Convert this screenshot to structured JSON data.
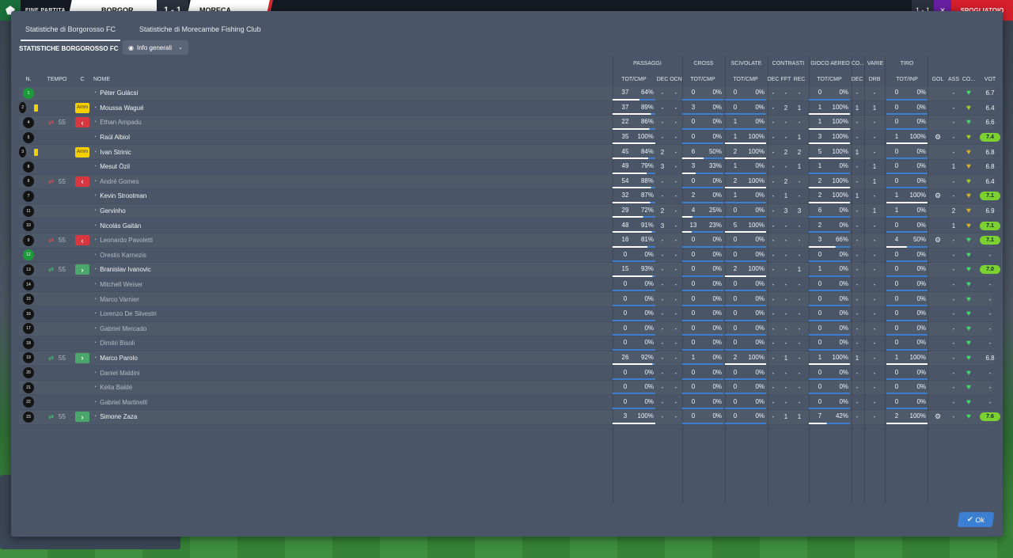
{
  "topbar": {
    "left_label": "FINE PARTITA",
    "home_team": "BORGOR",
    "away_team": "MORECA",
    "score": "1 - 1",
    "mini_score": "1 - 1",
    "right_label": "SPOGLIATOIO"
  },
  "dialog": {
    "tabs": [
      "Statistiche di Borgorosso FC",
      "Statistiche di Morecambe Fishing Club"
    ],
    "section_title": "STATISTICHE BORGOROSSO FC",
    "dropdown_label": "Info generali",
    "ok_label": "Ok"
  },
  "groups": [
    {
      "label": "PASSAGGI",
      "span": "pass"
    },
    {
      "label": "CROSS",
      "span": "cross"
    },
    {
      "label": "SCIVOLATE",
      "span": "tackle"
    },
    {
      "label": "CONTRASTI",
      "span": "contr"
    },
    {
      "label": "GIOCO AEREO",
      "span": "air"
    },
    {
      "label": "CO...",
      "span": "co"
    },
    {
      "label": "VARIE",
      "span": "varie"
    },
    {
      "label": "TIRO",
      "span": "tiro"
    }
  ],
  "columns": {
    "n": "N.",
    "tempo": "TEMPO",
    "c": "C",
    "nome": "NOME",
    "pass_tot": "TOT/CMP",
    "dec": "DEC",
    "ocn": "OCN",
    "cross_tot": "TOT/CMP",
    "tackle_tot": "TOT/CMP",
    "contr_dec": "DEC",
    "contr_fft": "FFT",
    "contr_rec": "REC",
    "air_tot": "TOT/CMP",
    "co_dec": "DEC",
    "drb": "DRB",
    "tiro_tot": "TOT/INP",
    "gol": "GOL",
    "ass": "ASS",
    "co": "CO...",
    "vot": "VOT"
  },
  "players": [
    {
      "n": "1",
      "gk": true,
      "card": "",
      "tempo": "",
      "badge": "",
      "name": "Péter Gulácsi",
      "dim": false,
      "pass": [
        "37",
        "64%"
      ],
      "dec": "-",
      "ocn": "-",
      "cross": [
        "0",
        "0%"
      ],
      "tackle": [
        "0",
        "0%"
      ],
      "cd": "-",
      "cf": "-",
      "cr": "-",
      "air": [
        "0",
        "0%"
      ],
      "codec": "-",
      "drb": "-",
      "tiro": [
        "0",
        "0%"
      ],
      "gol": "",
      "ass": "-",
      "cond": "good",
      "vot": "6.7",
      "vot_hl": false
    },
    {
      "n": "2",
      "gk": false,
      "card": "y",
      "tempo": "",
      "badge": "amm",
      "badge_text": "Amm",
      "name": "Moussa Wagué",
      "dim": false,
      "pass": [
        "37",
        "89%"
      ],
      "dec": "-",
      "ocn": "-",
      "cross": [
        "3",
        "0%"
      ],
      "tackle": [
        "0",
        "0%"
      ],
      "cd": "-",
      "cf": "2",
      "cr": "1",
      "air": [
        "1",
        "100%"
      ],
      "codec": "1",
      "drb": "1",
      "tiro": [
        "0",
        "0%"
      ],
      "gol": "",
      "ass": "-",
      "cond": "warn",
      "vot": "6.4",
      "vot_hl": false
    },
    {
      "n": "4",
      "gk": false,
      "card": "",
      "sub": "out",
      "tempo": "55",
      "badge": "out",
      "badge_text": "‹",
      "name": "Ethan Ampadu",
      "dim": true,
      "pass": [
        "22",
        "86%"
      ],
      "dec": "-",
      "ocn": "-",
      "cross": [
        "0",
        "0%"
      ],
      "tackle": [
        "1",
        "0%"
      ],
      "cd": "-",
      "cf": "-",
      "cr": "-",
      "air": [
        "1",
        "100%"
      ],
      "codec": "-",
      "drb": "-",
      "tiro": [
        "0",
        "0%"
      ],
      "gol": "",
      "ass": "-",
      "cond": "good",
      "vot": "6.6",
      "vot_hl": false
    },
    {
      "n": "5",
      "gk": false,
      "card": "",
      "tempo": "",
      "badge": "",
      "name": "Raúl Albiol",
      "dim": false,
      "pass": [
        "35",
        "100%"
      ],
      "dec": "-",
      "ocn": "-",
      "cross": [
        "0",
        "0%"
      ],
      "tackle": [
        "1",
        "100%"
      ],
      "cd": "-",
      "cf": "-",
      "cr": "1",
      "air": [
        "3",
        "100%"
      ],
      "codec": "-",
      "drb": "-",
      "tiro": [
        "1",
        "100%"
      ],
      "gol": "cog",
      "ass": "-",
      "cond": "warn",
      "vot": "7.4",
      "vot_hl": true
    },
    {
      "n": "3",
      "gk": false,
      "card": "y",
      "tempo": "",
      "badge": "amm",
      "badge_text": "Amm",
      "name": "Ivan Strinic",
      "dim": false,
      "pass": [
        "45",
        "84%"
      ],
      "dec": "2",
      "ocn": "-",
      "cross": [
        "6",
        "50%"
      ],
      "tackle": [
        "2",
        "100%"
      ],
      "cd": "-",
      "cf": "2",
      "cr": "2",
      "air": [
        "5",
        "100%"
      ],
      "codec": "1",
      "drb": "-",
      "tiro": [
        "0",
        "0%"
      ],
      "gol": "",
      "ass": "-",
      "cond": "mid",
      "vot": "6.8",
      "vot_hl": false
    },
    {
      "n": "8",
      "gk": false,
      "card": "",
      "tempo": "",
      "badge": "",
      "name": "Mesut Özil",
      "dim": false,
      "pass": [
        "49",
        "79%"
      ],
      "dec": "3",
      "ocn": "-",
      "cross": [
        "3",
        "33%"
      ],
      "tackle": [
        "1",
        "0%"
      ],
      "cd": "-",
      "cf": "-",
      "cr": "1",
      "air": [
        "1",
        "0%"
      ],
      "codec": "-",
      "drb": "1",
      "tiro": [
        "0",
        "0%"
      ],
      "gol": "",
      "ass": "1",
      "cond": "mid",
      "vot": "6.8",
      "vot_hl": false
    },
    {
      "n": "6",
      "gk": false,
      "card": "",
      "sub": "out",
      "tempo": "55",
      "badge": "out",
      "badge_text": "‹",
      "name": "André Gomes",
      "dim": true,
      "pass": [
        "54",
        "88%"
      ],
      "dec": "-",
      "ocn": "-",
      "cross": [
        "0",
        "0%"
      ],
      "tackle": [
        "2",
        "100%"
      ],
      "cd": "-",
      "cf": "2",
      "cr": "-",
      "air": [
        "2",
        "100%"
      ],
      "codec": "-",
      "drb": "1",
      "tiro": [
        "0",
        "0%"
      ],
      "gol": "",
      "ass": "-",
      "cond": "warn",
      "vot": "6.4",
      "vot_hl": false
    },
    {
      "n": "7",
      "gk": false,
      "card": "",
      "tempo": "",
      "badge": "",
      "name": "Kevin Strootman",
      "dim": false,
      "pass": [
        "32",
        "87%"
      ],
      "dec": "-",
      "ocn": "-",
      "cross": [
        "2",
        "0%"
      ],
      "tackle": [
        "1",
        "0%"
      ],
      "cd": "-",
      "cf": "1",
      "cr": "-",
      "air": [
        "2",
        "100%"
      ],
      "codec": "1",
      "drb": "-",
      "tiro": [
        "1",
        "100%"
      ],
      "gol": "cog",
      "ass": "-",
      "cond": "mid",
      "vot": "7.1",
      "vot_hl": true
    },
    {
      "n": "11",
      "gk": false,
      "card": "",
      "tempo": "",
      "badge": "",
      "name": "Gervinho",
      "dim": false,
      "pass": [
        "29",
        "72%"
      ],
      "dec": "2",
      "ocn": "-",
      "cross": [
        "4",
        "25%"
      ],
      "tackle": [
        "0",
        "0%"
      ],
      "cd": "-",
      "cf": "3",
      "cr": "3",
      "air": [
        "6",
        "0%"
      ],
      "codec": "-",
      "drb": "1",
      "tiro": [
        "1",
        "0%"
      ],
      "gol": "",
      "ass": "2",
      "cond": "mid",
      "vot": "6.9",
      "vot_hl": false
    },
    {
      "n": "10",
      "gk": false,
      "card": "",
      "tempo": "",
      "badge": "",
      "name": "Nicolás Gaitán",
      "dim": false,
      "pass": [
        "48",
        "91%"
      ],
      "dec": "3",
      "ocn": "-",
      "cross": [
        "13",
        "23%"
      ],
      "tackle": [
        "5",
        "100%"
      ],
      "cd": "-",
      "cf": "-",
      "cr": "-",
      "air": [
        "2",
        "0%"
      ],
      "codec": "-",
      "drb": "-",
      "tiro": [
        "0",
        "0%"
      ],
      "gol": "",
      "ass": "1",
      "cond": "mid",
      "vot": "7.1",
      "vot_hl": true
    },
    {
      "n": "9",
      "gk": false,
      "card": "",
      "sub": "out",
      "tempo": "55",
      "badge": "out",
      "badge_text": "‹",
      "name": "Leonardo Pavoletti",
      "dim": true,
      "pass": [
        "16",
        "81%"
      ],
      "dec": "-",
      "ocn": "-",
      "cross": [
        "0",
        "0%"
      ],
      "tackle": [
        "0",
        "0%"
      ],
      "cd": "-",
      "cf": "-",
      "cr": "-",
      "air": [
        "3",
        "66%"
      ],
      "codec": "-",
      "drb": "-",
      "tiro": [
        "4",
        "50%"
      ],
      "gol": "cog",
      "ass": "-",
      "cond": "good",
      "vot": "7.1",
      "vot_hl": true
    },
    {
      "n": "12",
      "gk": true,
      "card": "",
      "tempo": "",
      "badge": "",
      "name": "Orestis Karnezis",
      "dim": true,
      "pass": [
        "0",
        "0%"
      ],
      "dec": "-",
      "ocn": "-",
      "cross": [
        "0",
        "0%"
      ],
      "tackle": [
        "0",
        "0%"
      ],
      "cd": "-",
      "cf": "-",
      "cr": "-",
      "air": [
        "0",
        "0%"
      ],
      "codec": "-",
      "drb": "-",
      "tiro": [
        "0",
        "0%"
      ],
      "gol": "",
      "ass": "-",
      "cond": "good",
      "vot": "-",
      "vot_hl": false
    },
    {
      "n": "13",
      "gk": false,
      "card": "",
      "sub": "in",
      "tempo": "55",
      "badge": "in",
      "badge_text": "›",
      "name": "Branislav Ivanovic",
      "dim": false,
      "pass": [
        "15",
        "93%"
      ],
      "dec": "-",
      "ocn": "-",
      "cross": [
        "0",
        "0%"
      ],
      "tackle": [
        "2",
        "100%"
      ],
      "cd": "-",
      "cf": "-",
      "cr": "1",
      "air": [
        "1",
        "0%"
      ],
      "codec": "-",
      "drb": "-",
      "tiro": [
        "0",
        "0%"
      ],
      "gol": "",
      "ass": "-",
      "cond": "good",
      "vot": "7.0",
      "vot_hl": true
    },
    {
      "n": "14",
      "gk": false,
      "card": "",
      "tempo": "",
      "badge": "",
      "name": "Mitchell Weiser",
      "dim": true,
      "pass": [
        "0",
        "0%"
      ],
      "dec": "-",
      "ocn": "-",
      "cross": [
        "0",
        "0%"
      ],
      "tackle": [
        "0",
        "0%"
      ],
      "cd": "-",
      "cf": "-",
      "cr": "-",
      "air": [
        "0",
        "0%"
      ],
      "codec": "-",
      "drb": "-",
      "tiro": [
        "0",
        "0%"
      ],
      "gol": "",
      "ass": "-",
      "cond": "good",
      "vot": "-",
      "vot_hl": false
    },
    {
      "n": "15",
      "gk": false,
      "card": "",
      "tempo": "",
      "badge": "",
      "name": "Marco Varnier",
      "dim": true,
      "pass": [
        "0",
        "0%"
      ],
      "dec": "-",
      "ocn": "-",
      "cross": [
        "0",
        "0%"
      ],
      "tackle": [
        "0",
        "0%"
      ],
      "cd": "-",
      "cf": "-",
      "cr": "-",
      "air": [
        "0",
        "0%"
      ],
      "codec": "-",
      "drb": "-",
      "tiro": [
        "0",
        "0%"
      ],
      "gol": "",
      "ass": "-",
      "cond": "good",
      "vot": "-",
      "vot_hl": false
    },
    {
      "n": "16",
      "gk": false,
      "card": "",
      "tempo": "",
      "badge": "",
      "name": "Lorenzo De Silvestri",
      "dim": true,
      "pass": [
        "0",
        "0%"
      ],
      "dec": "-",
      "ocn": "-",
      "cross": [
        "0",
        "0%"
      ],
      "tackle": [
        "0",
        "0%"
      ],
      "cd": "-",
      "cf": "-",
      "cr": "-",
      "air": [
        "0",
        "0%"
      ],
      "codec": "-",
      "drb": "-",
      "tiro": [
        "0",
        "0%"
      ],
      "gol": "",
      "ass": "-",
      "cond": "good",
      "vot": "-",
      "vot_hl": false
    },
    {
      "n": "17",
      "gk": false,
      "card": "",
      "tempo": "",
      "badge": "",
      "name": "Gabriel Mercado",
      "dim": true,
      "pass": [
        "0",
        "0%"
      ],
      "dec": "-",
      "ocn": "-",
      "cross": [
        "0",
        "0%"
      ],
      "tackle": [
        "0",
        "0%"
      ],
      "cd": "-",
      "cf": "-",
      "cr": "-",
      "air": [
        "0",
        "0%"
      ],
      "codec": "-",
      "drb": "-",
      "tiro": [
        "0",
        "0%"
      ],
      "gol": "",
      "ass": "-",
      "cond": "good",
      "vot": "-",
      "vot_hl": false
    },
    {
      "n": "18",
      "gk": false,
      "card": "",
      "tempo": "",
      "badge": "",
      "name": "Dimitri Bisoli",
      "dim": true,
      "pass": [
        "0",
        "0%"
      ],
      "dec": "-",
      "ocn": "-",
      "cross": [
        "0",
        "0%"
      ],
      "tackle": [
        "0",
        "0%"
      ],
      "cd": "-",
      "cf": "-",
      "cr": "-",
      "air": [
        "0",
        "0%"
      ],
      "codec": "-",
      "drb": "-",
      "tiro": [
        "0",
        "0%"
      ],
      "gol": "",
      "ass": "-",
      "cond": "good",
      "vot": "-",
      "vot_hl": false
    },
    {
      "n": "19",
      "gk": false,
      "card": "",
      "sub": "in",
      "tempo": "55",
      "badge": "in",
      "badge_text": "›",
      "name": "Marco Parolo",
      "dim": false,
      "pass": [
        "26",
        "92%"
      ],
      "dec": "-",
      "ocn": "-",
      "cross": [
        "1",
        "0%"
      ],
      "tackle": [
        "2",
        "100%"
      ],
      "cd": "-",
      "cf": "1",
      "cr": "-",
      "air": [
        "1",
        "100%"
      ],
      "codec": "1",
      "drb": "-",
      "tiro": [
        "1",
        "100%"
      ],
      "gol": "",
      "ass": "-",
      "cond": "good",
      "vot": "6.8",
      "vot_hl": false
    },
    {
      "n": "20",
      "gk": false,
      "card": "",
      "tempo": "",
      "badge": "",
      "name": "Daniel Maldini",
      "dim": true,
      "pass": [
        "0",
        "0%"
      ],
      "dec": "-",
      "ocn": "-",
      "cross": [
        "0",
        "0%"
      ],
      "tackle": [
        "0",
        "0%"
      ],
      "cd": "-",
      "cf": "-",
      "cr": "-",
      "air": [
        "0",
        "0%"
      ],
      "codec": "-",
      "drb": "-",
      "tiro": [
        "0",
        "0%"
      ],
      "gol": "",
      "ass": "-",
      "cond": "good",
      "vot": "-",
      "vot_hl": false
    },
    {
      "n": "21",
      "gk": false,
      "card": "",
      "tempo": "",
      "badge": "",
      "name": "Keita Baldé",
      "dim": true,
      "pass": [
        "0",
        "0%"
      ],
      "dec": "-",
      "ocn": "-",
      "cross": [
        "0",
        "0%"
      ],
      "tackle": [
        "0",
        "0%"
      ],
      "cd": "-",
      "cf": "-",
      "cr": "-",
      "air": [
        "0",
        "0%"
      ],
      "codec": "-",
      "drb": "-",
      "tiro": [
        "0",
        "0%"
      ],
      "gol": "",
      "ass": "-",
      "cond": "good",
      "vot": "-",
      "vot_hl": false
    },
    {
      "n": "22",
      "gk": false,
      "card": "",
      "tempo": "",
      "badge": "",
      "name": "Gabriel Martinelli",
      "dim": true,
      "pass": [
        "0",
        "0%"
      ],
      "dec": "-",
      "ocn": "-",
      "cross": [
        "0",
        "0%"
      ],
      "tackle": [
        "0",
        "0%"
      ],
      "cd": "-",
      "cf": "-",
      "cr": "-",
      "air": [
        "0",
        "0%"
      ],
      "codec": "-",
      "drb": "-",
      "tiro": [
        "0",
        "0%"
      ],
      "gol": "",
      "ass": "-",
      "cond": "good",
      "vot": "-",
      "vot_hl": false
    },
    {
      "n": "23",
      "gk": false,
      "card": "",
      "sub": "in",
      "tempo": "55",
      "badge": "in",
      "badge_text": "›",
      "name": "Simone Zaza",
      "dim": false,
      "pass": [
        "3",
        "100%"
      ],
      "dec": "-",
      "ocn": "-",
      "cross": [
        "0",
        "0%"
      ],
      "tackle": [
        "0",
        "0%"
      ],
      "cd": "-",
      "cf": "1",
      "cr": "1",
      "air": [
        "7",
        "42%"
      ],
      "codec": "-",
      "drb": "-",
      "tiro": [
        "2",
        "100%"
      ],
      "gol": "cog",
      "ass": "-",
      "cond": "good",
      "vot": "7.6",
      "vot_hl": true
    }
  ],
  "colors": {
    "accent": "#3a7fd1",
    "rating": "#7ad12f",
    "condition_good": "#46d66a",
    "condition_warn": "#b8d12f",
    "card": "#f5d000"
  },
  "icons": {
    "brand": "club-crest-icon",
    "eye": "eye-icon",
    "chev": "chevron-down-icon",
    "head": "player-head-icon",
    "cog": "settings-cog-icon",
    "heart": "condition-heart-icon",
    "check": "check-icon"
  }
}
